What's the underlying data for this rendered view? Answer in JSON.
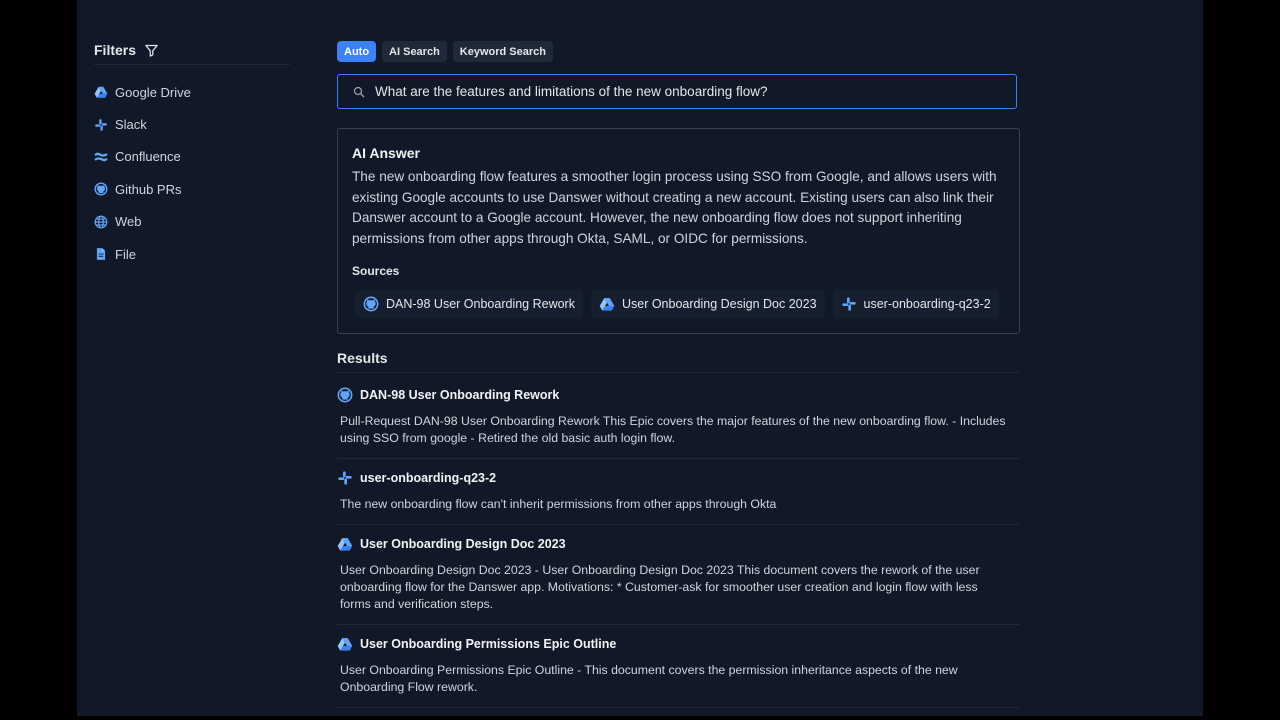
{
  "colors": {
    "accent": "#3b82f6",
    "background": "#111827",
    "page_bg": "#000000",
    "border": "#374151"
  },
  "sidebar": {
    "title": "Filters",
    "title_icon": "filter-icon",
    "sources": [
      {
        "label": "Google Drive",
        "icon": "google-drive-icon"
      },
      {
        "label": "Slack",
        "icon": "slack-icon"
      },
      {
        "label": "Confluence",
        "icon": "confluence-icon"
      },
      {
        "label": "Github PRs",
        "icon": "github-icon"
      },
      {
        "label": "Web",
        "icon": "globe-icon"
      },
      {
        "label": "File",
        "icon": "file-icon"
      }
    ]
  },
  "search_modes": [
    {
      "label": "Auto",
      "active": true
    },
    {
      "label": "AI Search",
      "active": false
    },
    {
      "label": "Keyword Search",
      "active": false
    }
  ],
  "search": {
    "value": "What are the features and limitations of the new onboarding flow?",
    "icon": "search-icon"
  },
  "answer": {
    "title": "AI Answer",
    "text": "The new onboarding flow features a smoother login process using SSO from Google, and allows users with existing Google accounts to use Danswer without creating a new account. Existing users can also link their Danswer account to a Google account. However, the new onboarding flow does not support inheriting permissions from other apps through Okta, SAML, or OIDC for permissions.",
    "sources_title": "Sources",
    "sources": [
      {
        "label": "DAN-98 User Onboarding Rework",
        "icon": "github-icon"
      },
      {
        "label": "User Onboarding Design Doc 2023",
        "icon": "google-drive-icon"
      },
      {
        "label": "user-onboarding-q23-2",
        "icon": "slack-icon"
      }
    ]
  },
  "results": {
    "title": "Results",
    "items": [
      {
        "title": "DAN-98 User Onboarding Rework",
        "icon": "github-icon",
        "body": "Pull-Request DAN-98 User Onboarding Rework This Epic covers the major features of the new onboarding flow. - Includes using SSO from google - Retired the old basic auth login flow."
      },
      {
        "title": "user-onboarding-q23-2",
        "icon": "slack-icon",
        "body": "The new onboarding flow can't inherit permissions from other apps through Okta"
      },
      {
        "title": "User Onboarding Design Doc 2023",
        "icon": "google-drive-icon",
        "body": "User Onboarding Design Doc 2023 - User Onboarding Design Doc 2023 This document covers the rework of the user onboarding flow for the Danswer app. Motivations: * Customer-ask for smoother user creation and login flow with less forms and verification steps."
      },
      {
        "title": "User Onboarding Permissions Epic Outline",
        "icon": "google-drive-icon",
        "body": "User Onboarding Permissions Epic Outline - This document covers the permission inheritance aspects of the new Onboarding Flow rework."
      }
    ]
  }
}
